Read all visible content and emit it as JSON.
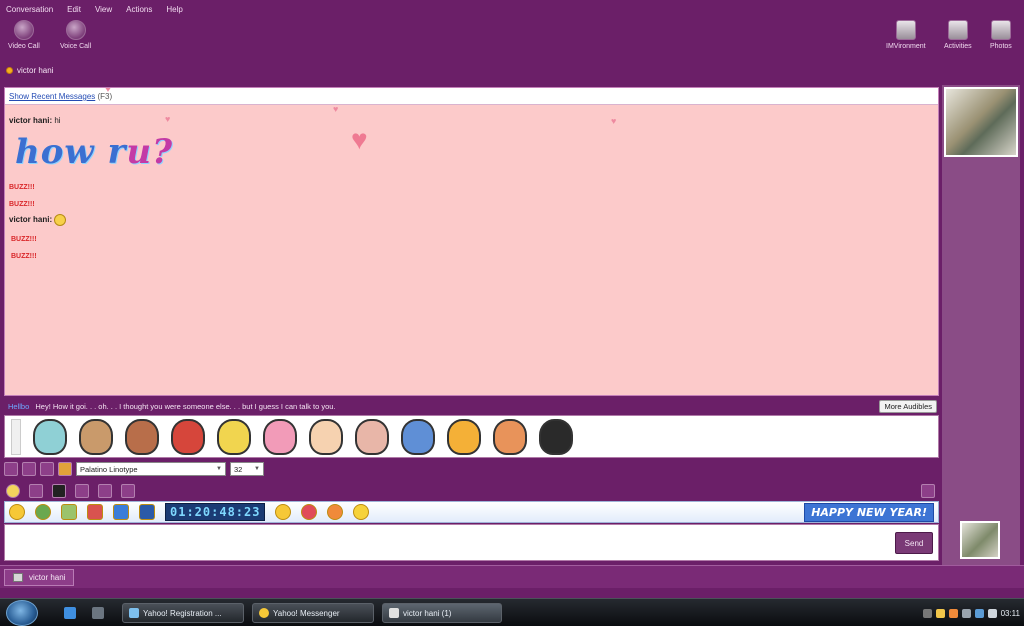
{
  "menu": [
    "Conversation",
    "Edit",
    "View",
    "Actions",
    "Help"
  ],
  "toolbar_left": [
    {
      "label": "Video Call",
      "icon": "video-call-icon"
    },
    {
      "label": "Voice Call",
      "icon": "microphone-icon"
    }
  ],
  "toolbar_right": [
    {
      "label": "IMVironment",
      "icon": "imvironment-icon"
    },
    {
      "label": "Activities",
      "icon": "activities-icon"
    },
    {
      "label": "Photos",
      "icon": "photos-icon"
    }
  ],
  "contact": {
    "name": "victor hani",
    "status_color": "#f3b021"
  },
  "chat": {
    "recent_link": "Show Recent Messages",
    "recent_shortcut": "(F3)",
    "bg_color": "#fccaca",
    "messages": [
      {
        "sender": "victor hani:",
        "text": "hi"
      },
      {
        "sender": "victor hani:",
        "text": ""
      }
    ],
    "art_text_main": "how r",
    "art_text_tail": "u?",
    "buzzes": [
      "BUZZ!!!",
      "BUZZ!!!",
      "BUZZ!!!",
      "BUZZ!!!"
    ]
  },
  "audible": {
    "who": "Hellbo",
    "text": "Hey! How it goi. . . oh. . . I thought you were someone else. . . but I guess I can talk to you.",
    "more_label": "More Audibles"
  },
  "format": {
    "font": "Palatino Linotype",
    "size": "32"
  },
  "emote": {
    "timer": "01:20:48:23",
    "banner": "HAPPY NEW YEAR!"
  },
  "input": {
    "send_label": "Send",
    "placeholder": ""
  },
  "tab": {
    "label": "victor hani"
  },
  "taskbar": {
    "tasks": [
      "Yahoo! Registration ...",
      "Yahoo! Messenger",
      "victor hani (1)"
    ],
    "clock": "03:11"
  },
  "colors": {
    "accent": "#6b1f68",
    "panel": "#8a4c86"
  }
}
